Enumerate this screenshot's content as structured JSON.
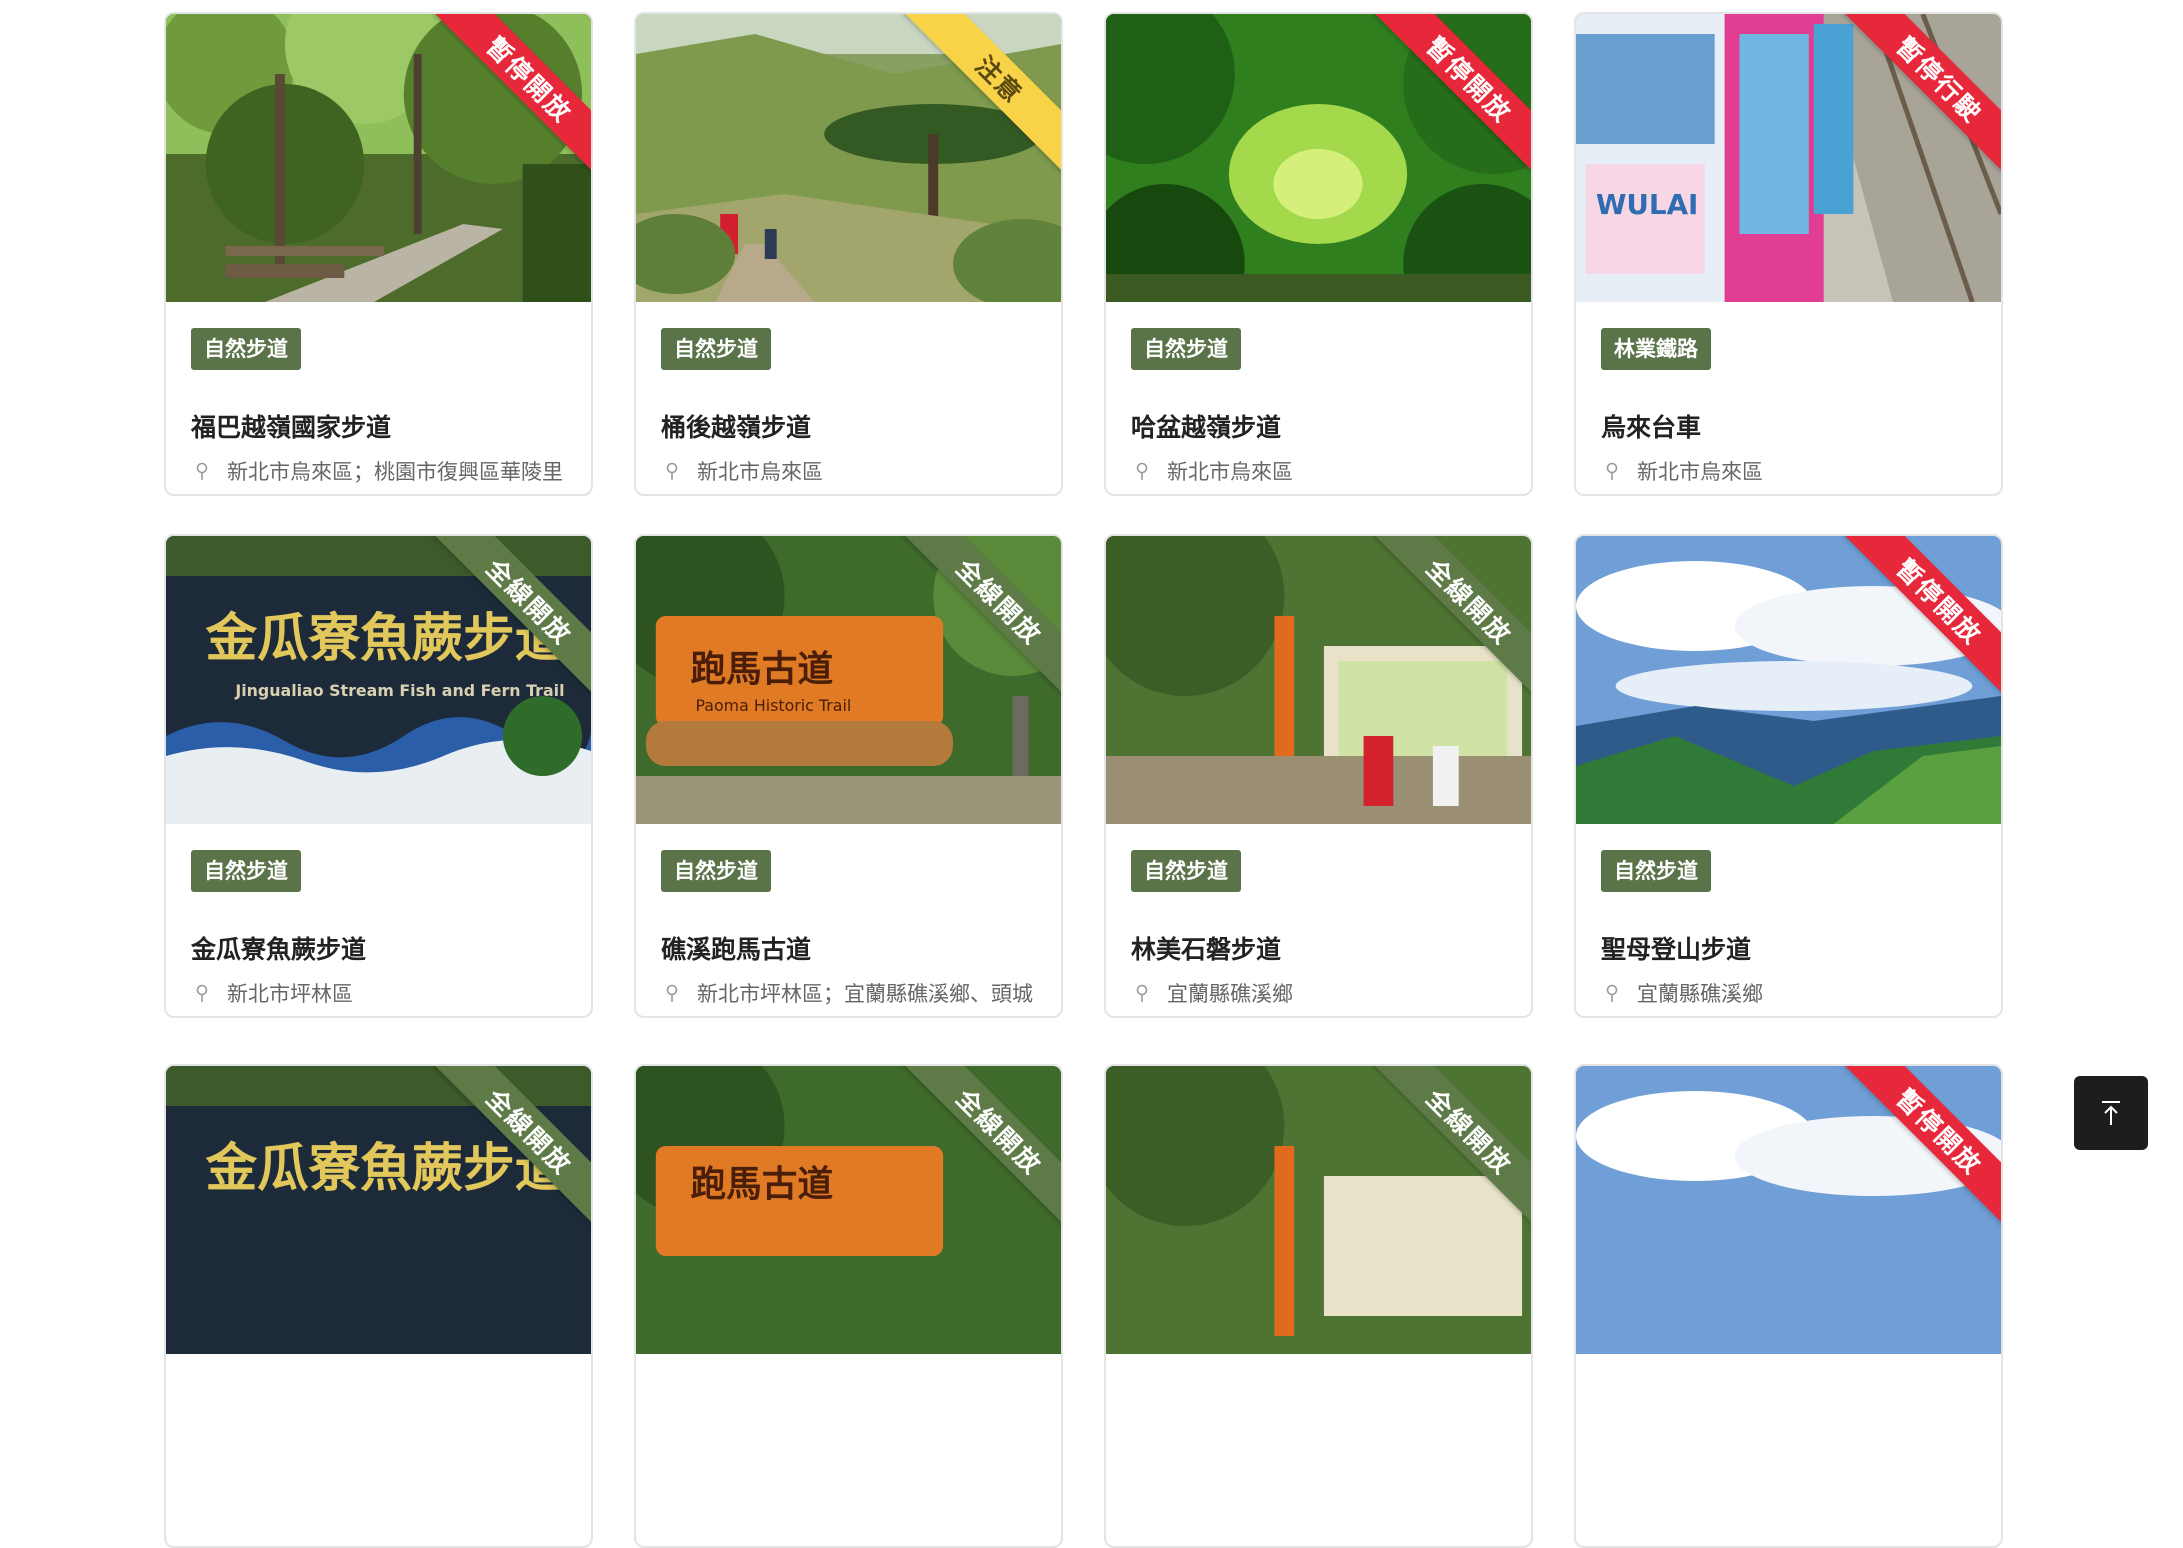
{
  "cards": [
    {
      "status": "暫停開放",
      "category": "自然步道",
      "title": "福巴越嶺國家步道",
      "location": "新北市烏來區；桃園市復興區華陵里"
    },
    {
      "status": "注意",
      "category": "自然步道",
      "title": "桶後越嶺步道",
      "location": "新北市烏來區"
    },
    {
      "status": "暫停開放",
      "category": "自然步道",
      "title": "哈盆越嶺步道",
      "location": "新北市烏來區"
    },
    {
      "status": "暫停行駛",
      "category": "林業鐵路",
      "title": "烏來台車",
      "location": "新北市烏來區"
    },
    {
      "status": "全線開放",
      "category": "自然步道",
      "title": "金瓜寮魚蕨步道",
      "location": "新北市坪林區"
    },
    {
      "status": "全線開放",
      "category": "自然步道",
      "title": "礁溪跑馬古道",
      "location": "新北市坪林區；宜蘭縣礁溪鄉、頭城"
    },
    {
      "status": "全線開放",
      "category": "自然步道",
      "title": "林美石磐步道",
      "location": "宜蘭縣礁溪鄉"
    },
    {
      "status": "暫停開放",
      "category": "自然步道",
      "title": "聖母登山步道",
      "location": "宜蘭縣礁溪鄉"
    },
    {
      "status": "全線開放"
    },
    {
      "status": "全線開放"
    },
    {
      "status": "全線開放"
    },
    {
      "status": "暫停開放"
    }
  ],
  "images": {
    "sign_jinguaiao": "金瓜寮魚蕨步道",
    "sign_jinguaiao_en": "Jingualiao Stream Fish and Fern Trail",
    "sign_paoma": "跑馬古道",
    "sign_paoma_en": "Paoma Historic Trail",
    "sign_wulai": "WULAI"
  },
  "colors": {
    "red": "#e6283a",
    "yellow": "#f9d347",
    "green": "#5e7a47",
    "tag": "#5a7349"
  },
  "icons": {
    "location": "map-pin-icon",
    "back_to_top": "arrow-up-to-line-icon"
  }
}
